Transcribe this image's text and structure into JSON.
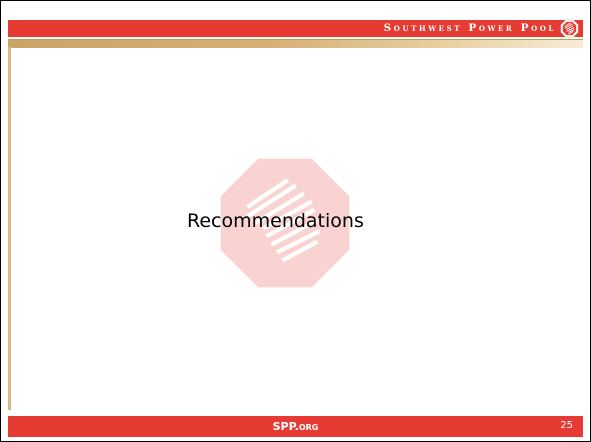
{
  "header": {
    "title": "Southwest Power Pool",
    "logo_icon": "spp-logo-icon"
  },
  "slide": {
    "title": "Recommendations",
    "watermark_icon": "spp-watermark-icon"
  },
  "footer": {
    "label": "SPP.org",
    "page_number": "25"
  },
  "colors": {
    "brand_red": "#e63b32",
    "gold": "#d4b074",
    "background": "#ffffff"
  }
}
